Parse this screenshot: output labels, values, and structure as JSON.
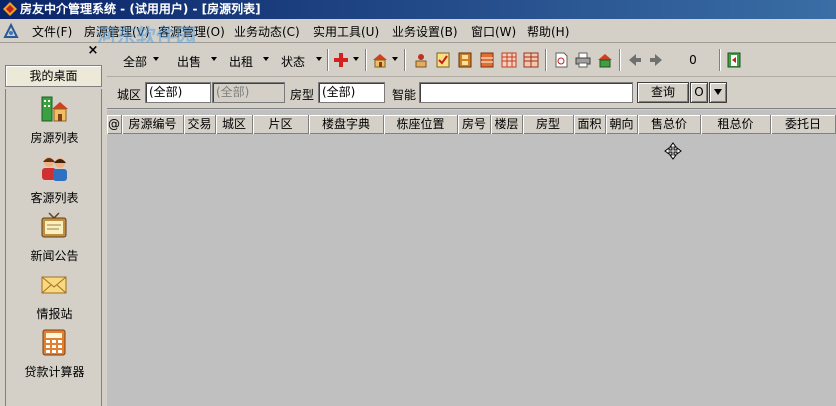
{
  "window": {
    "title": "房友中介管理系统 - (试用用户) - [房源列表]"
  },
  "menubar": {
    "items": [
      {
        "label": "文件(F)"
      },
      {
        "label": "房源管理(V)"
      },
      {
        "label": "客源管理(O)"
      },
      {
        "label": "业务动态(C)"
      },
      {
        "label": "实用工具(U)"
      },
      {
        "label": "业务设置(B)"
      },
      {
        "label": "窗口(W)"
      },
      {
        "label": "帮助(H)"
      }
    ],
    "watermark_text": "河东软件园",
    "watermark_url": "www.pc0359.cn"
  },
  "sidebar": {
    "close_glyph": "×",
    "header": "我的桌面",
    "items": [
      {
        "label": "房源列表",
        "icon": "house-list-icon"
      },
      {
        "label": "客源列表",
        "icon": "clients-icon"
      },
      {
        "label": "新闻公告",
        "icon": "tv-news-icon"
      },
      {
        "label": "情报站",
        "icon": "envelope-icon"
      },
      {
        "label": "贷款计算器",
        "icon": "calculator-icon"
      }
    ]
  },
  "toolbar": {
    "all_label": "全部",
    "sale_label": "出售",
    "rent_label": "出租",
    "status_label": "状态",
    "counter_value": "0"
  },
  "filterbar": {
    "district_label": "城区",
    "district_value": "(全部)",
    "area_value": "(全部)",
    "room_type_label": "房型",
    "room_type_value": "(全部)",
    "smart_label": "智能",
    "smart_value": "",
    "query_button": "查询",
    "option_button": "O"
  },
  "table": {
    "columns": [
      "@",
      "房源编号",
      "交易",
      "城区",
      "片区",
      "楼盘字典",
      "栋座位置",
      "房号",
      "楼层",
      "房型",
      "面积",
      "朝向",
      "售总价",
      "租总价",
      "委托日"
    ],
    "rows": []
  },
  "colors": {
    "titlebar": "#0a246a",
    "window_bg": "#d4d0c8",
    "table_bg": "#c0c0c0",
    "accent_red": "#d62020"
  }
}
